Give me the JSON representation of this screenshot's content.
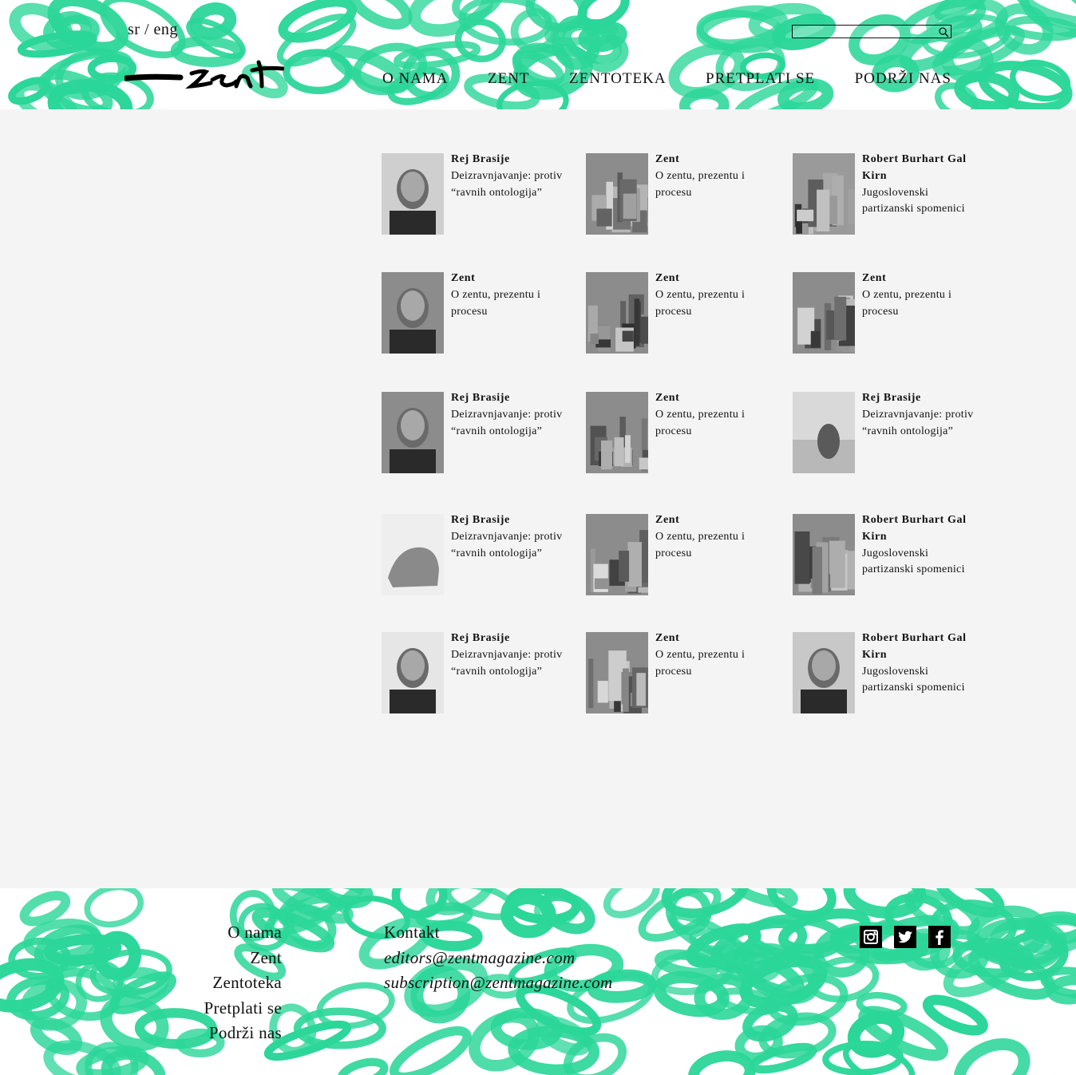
{
  "header": {
    "lang_sr": "sr",
    "lang_sep": "/",
    "lang_en": "eng",
    "logo_icon": "zent-brush-logo",
    "search_placeholder": "",
    "nav": [
      "O NAMA",
      "ZENT",
      "ZENTOTEKA",
      "PRETPLATI SE",
      "PODRŽI NAS"
    ]
  },
  "colors": {
    "accent_green": "#2bd699",
    "background": "#f4f4f4",
    "text": "#111111"
  },
  "grid": [
    {
      "author": "Rej Brasije",
      "title": "Deizravnjavanje: protiv “ravnih ontologija”",
      "image": "portrait-man-mustache"
    },
    {
      "author": "Zent",
      "title": "O zentu, prezentu i procesu",
      "image": "building-street-photo"
    },
    {
      "author": "Robert Burhart Gal Kirn",
      "title": "Jugoslovenski partizanski spomenici",
      "image": "city-map"
    },
    {
      "author": "Zent",
      "title": "O zentu, prezentu i procesu",
      "image": "man-seated-tv-studio"
    },
    {
      "author": "Zent",
      "title": "O zentu, prezentu i procesu",
      "image": "aerial-apartment-blocks"
    },
    {
      "author": "Zent",
      "title": "O zentu, prezentu i procesu",
      "image": "aerial-city-coast"
    },
    {
      "author": "Rej Brasije",
      "title": "Deizravnjavanje: protiv “ravnih ontologija”",
      "image": "monument-head-sculpture"
    },
    {
      "author": "Zent",
      "title": "O zentu, prezentu i procesu",
      "image": "collage-artwork"
    },
    {
      "author": "Rej Brasije",
      "title": "Deizravnjavanje: protiv “ravnih ontologija”",
      "image": "cat-on-sofa"
    },
    {
      "author": "Rej Brasije",
      "title": "Deizravnjavanje: protiv “ravnih ontologija”",
      "image": "rhinoceros-engraving"
    },
    {
      "author": "Zent",
      "title": "O zentu, prezentu i procesu",
      "image": "loop-sculpture-building"
    },
    {
      "author": "Robert Burhart Gal Kirn",
      "title": "Jugoslovenski partizanski spomenici",
      "image": "aerial-parking-lot"
    },
    {
      "author": "Rej Brasije",
      "title": "Deizravnjavanje: protiv “ravnih ontologija”",
      "image": "portrait-man-glasses"
    },
    {
      "author": "Zent",
      "title": "O zentu, prezentu i procesu",
      "image": "city-street-buildings"
    },
    {
      "author": "Robert Burhart Gal Kirn",
      "title": "Jugoslovenski partizanski spomenici",
      "image": "banknote-portrait"
    }
  ],
  "grid_text": [
    {
      "lines": [
        "Rej Brasije"
      ],
      "title_lines": [
        "Deizravnjavanje:",
        "protiv “ravnih",
        "ontologija”"
      ]
    },
    {
      "lines": [
        "Zent"
      ],
      "title_lines": [
        "O zentu, prezentu",
        "i procesu"
      ]
    },
    {
      "lines": [
        "Robert Burhart",
        "Gal Kirn"
      ],
      "title_lines": [
        "Jugoslovenski",
        "partizanski",
        "spomenici"
      ]
    }
  ],
  "footer": {
    "nav": [
      "O nama",
      "Zent",
      "Zentoteka",
      "Pretplati se",
      "Podrži nas"
    ],
    "contact_label": "Kontakt",
    "email_editors": "editors@zentmagazine.com",
    "email_subscription": "subscription@zentmagazine.com",
    "social": [
      "instagram-icon",
      "twitter-icon",
      "facebook-icon"
    ]
  }
}
